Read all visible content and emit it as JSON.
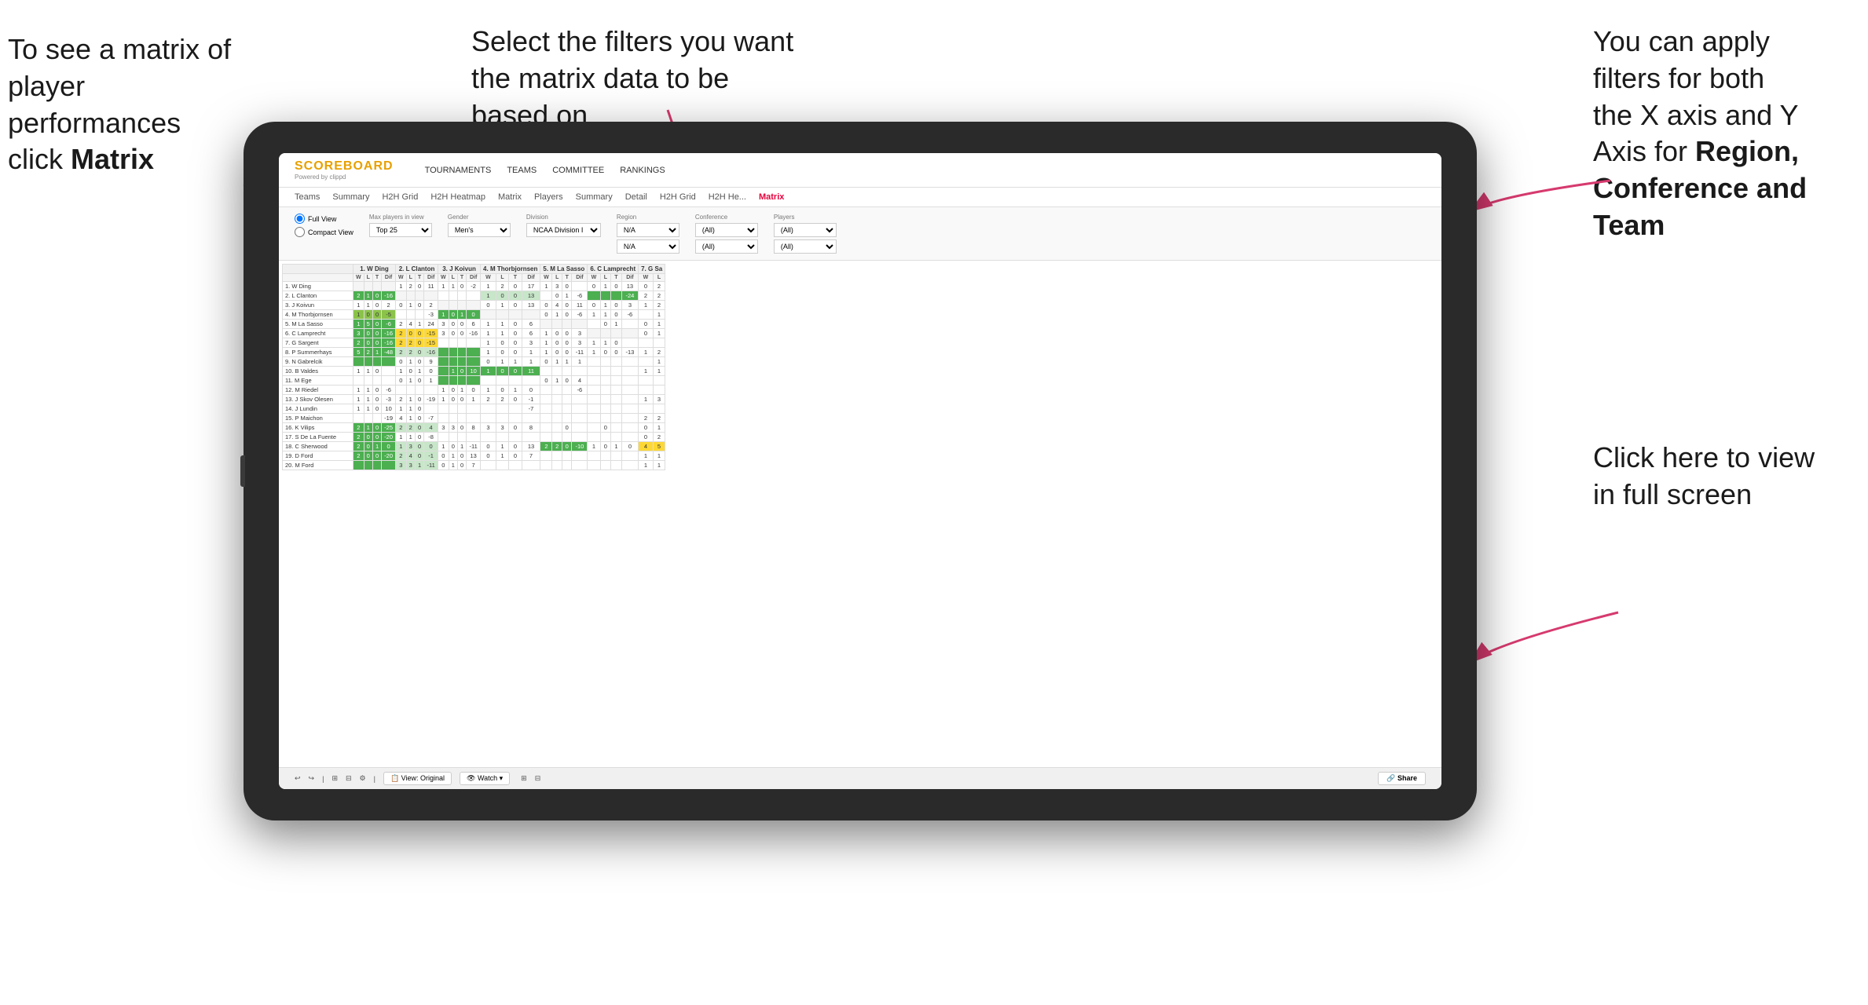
{
  "annotations": {
    "topleft": {
      "line1": "To see a matrix of",
      "line2": "player performances",
      "line3_regular": "click ",
      "line3_bold": "Matrix"
    },
    "topmid": {
      "text": "Select the filters you want the matrix data to be based on"
    },
    "topright": {
      "line1": "You  can apply",
      "line2": "filters for both",
      "line3": "the X axis and Y",
      "line4_regular": "Axis for ",
      "line4_bold": "Region,",
      "line5_bold": "Conference and",
      "line6_bold": "Team"
    },
    "bottomright": {
      "line1": "Click here to view",
      "line2": "in full screen"
    }
  },
  "app": {
    "logo": "SCOREBOARD",
    "logo_sub": "Powered by clippd",
    "nav_items": [
      "TOURNAMENTS",
      "TEAMS",
      "COMMITTEE",
      "RANKINGS"
    ],
    "sub_nav": [
      "Teams",
      "Summary",
      "H2H Grid",
      "H2H Heatmap",
      "Matrix",
      "Players",
      "Summary",
      "Detail",
      "H2H Grid",
      "H2H He...",
      "Matrix"
    ],
    "filters": {
      "view_full": "Full View",
      "view_compact": "Compact View",
      "max_players_label": "Max players in view",
      "max_players_val": "Top 25",
      "gender_label": "Gender",
      "gender_val": "Men's",
      "division_label": "Division",
      "division_val": "NCAA Division I",
      "region_label": "Region",
      "region_val1": "N/A",
      "region_val2": "N/A",
      "conference_label": "Conference",
      "conference_val1": "(All)",
      "conference_val2": "(All)",
      "players_label": "Players",
      "players_val1": "(All)",
      "players_val2": "(All)"
    },
    "matrix_headers": [
      "1. W Ding",
      "2. L Clanton",
      "3. J Koivun",
      "4. M Thorbjornsen",
      "5. M La Sasso",
      "6. C Lamprecht",
      "7. G Sa"
    ],
    "sub_headers": [
      "W",
      "L",
      "T",
      "Dif"
    ],
    "players": [
      "1. W Ding",
      "2. L Clanton",
      "3. J Koivun",
      "4. M Thorbjornsen",
      "5. M La Sasso",
      "6. C Lamprecht",
      "7. G Sargent",
      "8. P Summerhays",
      "9. N Gabrelcik",
      "10. B Valdes",
      "11. M Ege",
      "12. M Riedel",
      "13. J Skov Olesen",
      "14. J Lundin",
      "15. P Maichon",
      "16. K Vilips",
      "17. S De La Fuente",
      "18. C Sherwood",
      "19. D Ford",
      "20. M Ford"
    ],
    "toolbar": {
      "undo": "↩",
      "redo": "↪",
      "view_original": "View: Original",
      "watch": "Watch ▾",
      "share": "Share"
    }
  }
}
